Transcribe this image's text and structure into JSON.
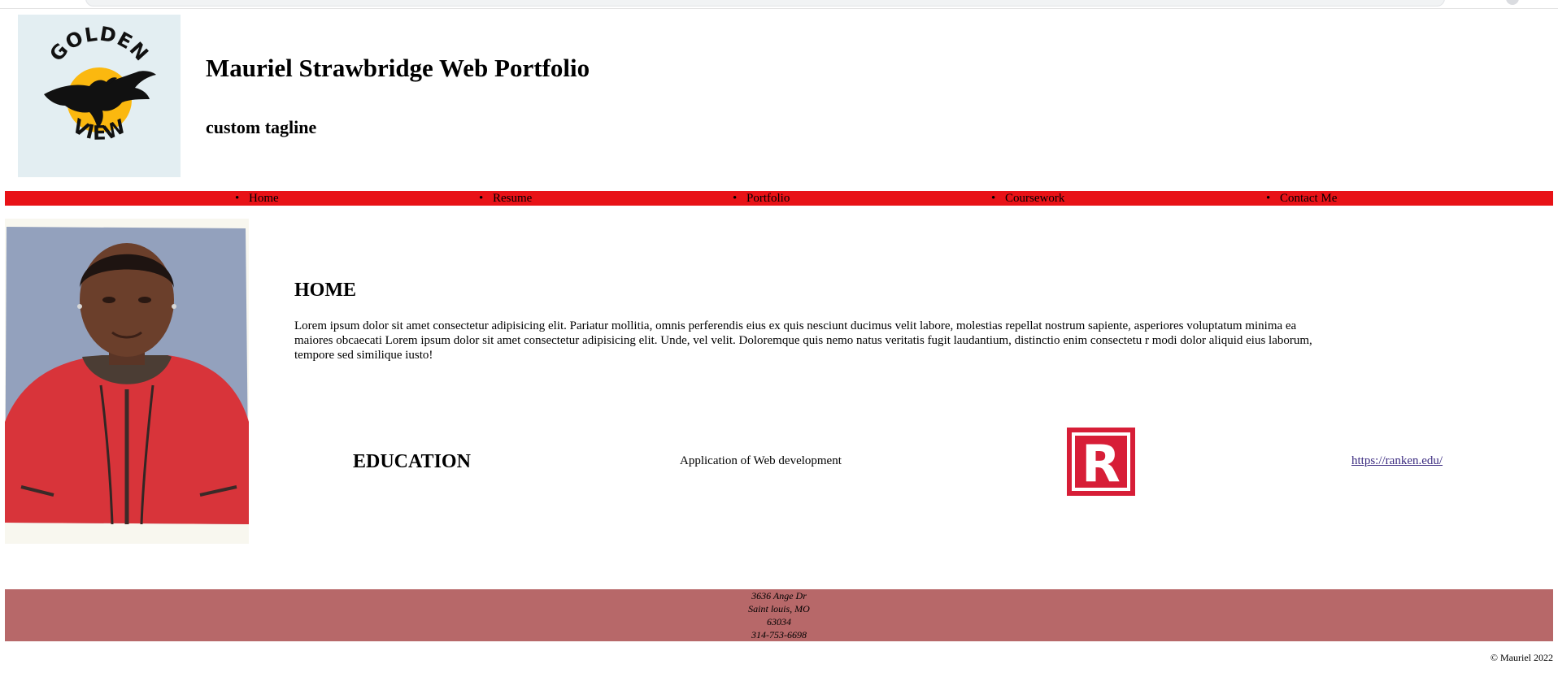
{
  "header": {
    "logo_text_top": "GOLDEN",
    "logo_text_bottom": "VIEW",
    "title": "Mauriel Strawbridge Web Portfolio",
    "tagline": "custom tagline"
  },
  "nav": {
    "items": [
      {
        "label": "Home"
      },
      {
        "label": "Resume"
      },
      {
        "label": "Portfolio"
      },
      {
        "label": "Coursework"
      },
      {
        "label": "Contact Me"
      }
    ]
  },
  "home": {
    "heading": "HOME",
    "body": "Lorem ipsum dolor sit amet consectetur adipisicing elit. Pariatur mollitia, omnis perferendis eius ex quis nesciunt ducimus velit labore, molestias repellat nostrum sapiente, asperiores voluptatum minima ea maiores obcaecati Lorem ipsum dolor sit amet consectetur adipisicing elit. Unde, vel velit. Doloremque quis nemo natus veritatis fugit laudantium, distinctio enim consectetu r modi dolor aliquid eius laborum, tempore sed similique iusto!"
  },
  "education": {
    "heading": "EDUCATION",
    "course": "Application of Web development",
    "logo_letter": "R",
    "link": "https://ranken.edu/"
  },
  "footer": {
    "address_line1": "3636 Ange Dr",
    "address_line2": "Saint louis, MO",
    "zip": "63034",
    "phone": "314-753-6698",
    "copyright": "© Mauriel 2022"
  },
  "colors": {
    "nav_bg": "#e81217",
    "footer_bg": "#b76869",
    "logo_sun": "#fbb80f",
    "logo_bg": "#e3eef2",
    "school_logo_red": "#d71e37",
    "link": "#3b2b80"
  },
  "icons": {
    "photo": "profile-photo",
    "site_logo": "golden-view-eagle-logo",
    "school_logo": "ranken-r-logo"
  }
}
